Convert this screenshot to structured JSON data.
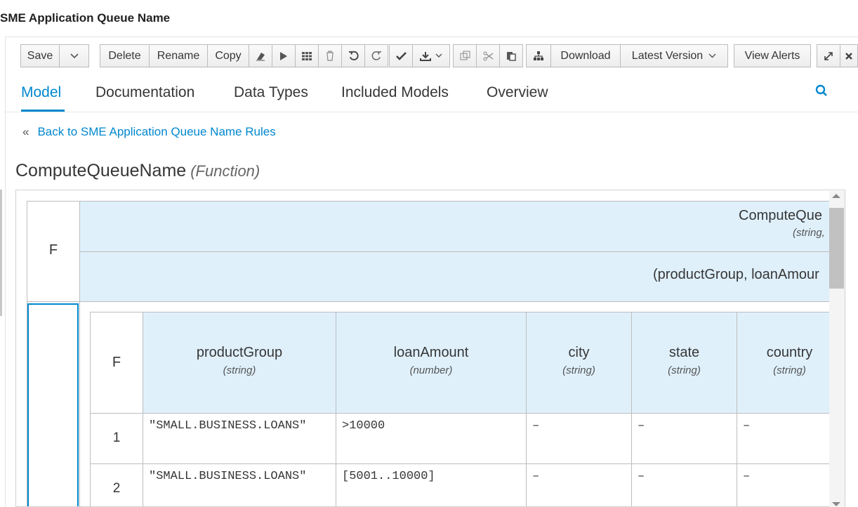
{
  "app": {
    "title": "SME Application Queue Name"
  },
  "toolbar": {
    "save": "Save",
    "delete": "Delete",
    "rename": "Rename",
    "copy": "Copy",
    "download": "Download",
    "version": "Latest Version",
    "view_alerts": "View Alerts",
    "caret": "∨"
  },
  "tabs": [
    "Model",
    "Documentation",
    "Data Types",
    "Included Models",
    "Overview"
  ],
  "back": {
    "chevron": "«",
    "label": "Back to SME Application Queue Name Rules"
  },
  "function": {
    "name": "ComputeQueueName",
    "kind": "(Function)"
  },
  "grid": {
    "hit_policy": "F",
    "outer_name": "ComputeQue",
    "outer_type": "(string,",
    "params": "(productGroup, loanAmour",
    "inner_hit_policy": "F",
    "columns": [
      {
        "name": "productGroup",
        "type": "(string)"
      },
      {
        "name": "loanAmount",
        "type": "(number)"
      },
      {
        "name": "city",
        "type": "(string)"
      },
      {
        "name": "state",
        "type": "(string)"
      },
      {
        "name": "country",
        "type": "(string)"
      }
    ],
    "rows": [
      {
        "num": "1",
        "cells": [
          "\"SMALL.BUSINESS.LOANS\"",
          ">10000",
          "–",
          "–",
          "–"
        ]
      },
      {
        "num": "2",
        "cells": [
          "\"SMALL.BUSINESS.LOANS\"",
          "[5001..10000]",
          "–",
          "–",
          "–"
        ]
      }
    ]
  },
  "colors": {
    "accent": "#0088ce",
    "header_bg": "#dff0fb"
  }
}
